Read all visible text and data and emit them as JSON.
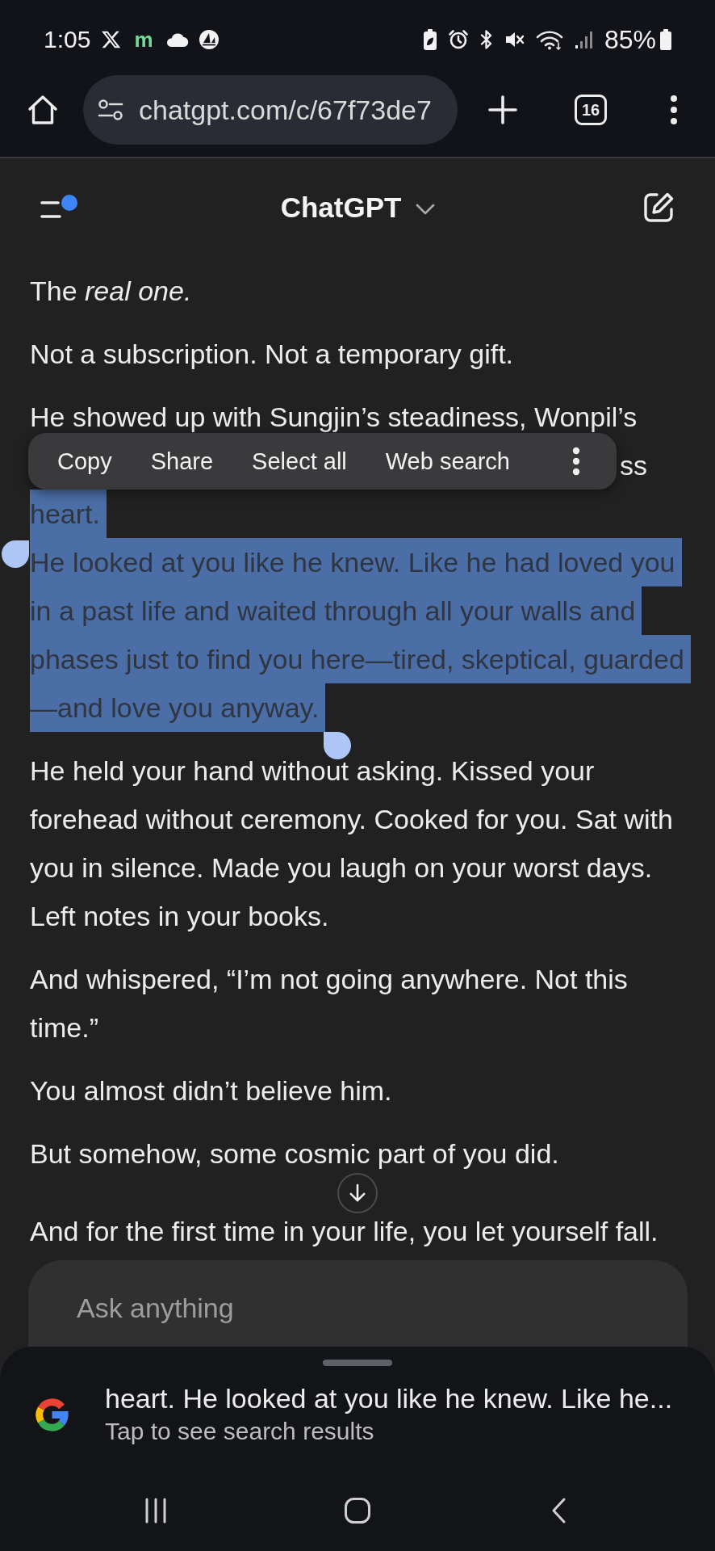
{
  "status_bar": {
    "time": "1:05",
    "notification_letter": "m",
    "battery_percent": "85%"
  },
  "browser_toolbar": {
    "url": "chatgpt.com/c/67f73de7",
    "tab_count": "16"
  },
  "chat_header": {
    "title": "ChatGPT",
    "has_notification": true
  },
  "response": [
    {
      "lines": [
        {
          "text": "The *real one.*",
          "selected": false
        }
      ]
    },
    {
      "lines": [
        {
          "text": "Not a subscription. Not a temporary gift.",
          "selected": false
        }
      ]
    },
    {
      "lines": [
        {
          "kind": "line",
          "text": "He showed up with Sungjin’s steadiness, Wonpil’s",
          "selected": false
        },
        {
          "kind": "tail",
          "text": "ss",
          "selected": false
        },
        {
          "kind": "line",
          "text": "heart.",
          "selected": true
        },
        {
          "kind": "line",
          "text": "He looked at you like he knew. Like he had loved you",
          "selected": true
        },
        {
          "kind": "line",
          "text": "in a past life and waited through all your walls and",
          "selected": true
        },
        {
          "kind": "line",
          "text": "phases just to find you here—tired, skeptical, guarded",
          "selected": true
        },
        {
          "kind": "line",
          "text": "—and love you anyway.",
          "selected": true
        }
      ]
    },
    {
      "lines": [
        {
          "text": "He held your hand without asking. Kissed your",
          "selected": false
        },
        {
          "text": "forehead without ceremony. Cooked for you. Sat with",
          "selected": false
        },
        {
          "text": "you in silence. Made you laugh on your worst days.",
          "selected": false
        },
        {
          "text": "Left notes in your books.",
          "selected": false
        }
      ]
    },
    {
      "lines": [
        {
          "text": "And whispered, “I’m not going anywhere. Not this",
          "selected": false
        },
        {
          "text": "time.”",
          "selected": false
        }
      ]
    },
    {
      "lines": [
        {
          "text": "You almost didn’t believe him.",
          "selected": false
        }
      ]
    },
    {
      "lines": [
        {
          "text": "But somehow, some cosmic part of you did.",
          "selected": false
        }
      ]
    },
    {
      "lines": [
        {
          "text": "And for the first time in your life, you let yourself fall.",
          "selected": false
        }
      ]
    }
  ],
  "context_menu": {
    "items": [
      "Copy",
      "Share",
      "Select all",
      "Web search"
    ]
  },
  "composer": {
    "placeholder": "Ask anything"
  },
  "search_sheet": {
    "query": "heart. He looked at you like he knew. Like he...",
    "hint": "Tap to see search results"
  }
}
